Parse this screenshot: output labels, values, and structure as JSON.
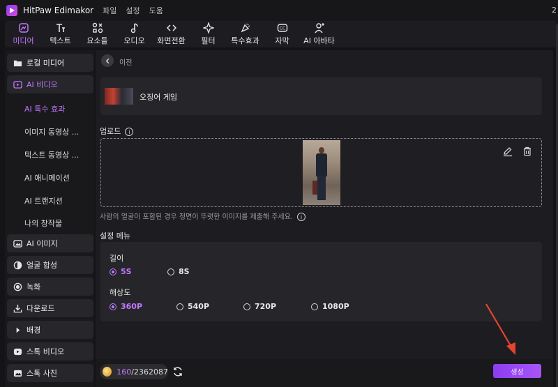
{
  "titlebar": {
    "app_name": "HitPaw Edimakor",
    "menus": [
      "파일",
      "설정",
      "도움"
    ],
    "right_text": "2"
  },
  "toolbar": {
    "tools": [
      {
        "label": "미디어",
        "icon": "media-icon",
        "active": true
      },
      {
        "label": "텍스트",
        "icon": "text-icon"
      },
      {
        "label": "요소들",
        "icon": "elements-icon"
      },
      {
        "label": "오디오",
        "icon": "audio-icon"
      },
      {
        "label": "화면전환",
        "icon": "transition-icon"
      },
      {
        "label": "필터",
        "icon": "filter-icon"
      },
      {
        "label": "특수효과",
        "icon": "effects-icon"
      },
      {
        "label": "자막",
        "icon": "subtitle-icon"
      },
      {
        "label": "AI 아바타",
        "icon": "avatar-icon"
      }
    ]
  },
  "sidebar": {
    "items": [
      {
        "label": "로컬 미디어",
        "icon": "folder-icon"
      },
      {
        "label": "AI 비디오",
        "icon": "ai-video-icon",
        "active": true
      },
      {
        "label": "AI 이미지",
        "icon": "ai-image-icon"
      },
      {
        "label": "얼굴 합성",
        "icon": "face-swap-icon"
      },
      {
        "label": "녹화",
        "icon": "record-icon"
      },
      {
        "label": "다운로드",
        "icon": "download-icon"
      },
      {
        "label": "배경",
        "icon": "background-icon"
      },
      {
        "label": "스톡 비디오",
        "icon": "stock-video-icon"
      },
      {
        "label": "스톡 사진",
        "icon": "stock-photo-icon"
      }
    ],
    "sub_items": [
      {
        "label": "AI 특수 효과",
        "active": true
      },
      {
        "label": "이미지 동영상 ..."
      },
      {
        "label": "텍스트 동영상 ..."
      },
      {
        "label": "AI 애니메이션"
      },
      {
        "label": "AI 트랜지션"
      },
      {
        "label": "나의 창작물"
      }
    ]
  },
  "main": {
    "back_label": "이전",
    "project_title": "오징어 게임",
    "upload_label": "업로드",
    "upload_hint": "사람의 얼굴이 포함된 경우 정면이 뚜렷한 이미지를 제출해 주세요.",
    "settings_label": "설정 메뉴",
    "length_title": "길이",
    "length_options": [
      "5S",
      "8S"
    ],
    "length_selected": "5S",
    "resolution_title": "해상도",
    "resolution_options": [
      "360P",
      "540P",
      "720P",
      "1080P"
    ],
    "resolution_selected": "360P"
  },
  "bottombar": {
    "credits_used": "160",
    "credits_total": "/2362087",
    "generate_label": "생성"
  },
  "colors": {
    "accent": "#c277ff",
    "button": "#9a4af5",
    "annotation_arrow": "#e4452d"
  }
}
